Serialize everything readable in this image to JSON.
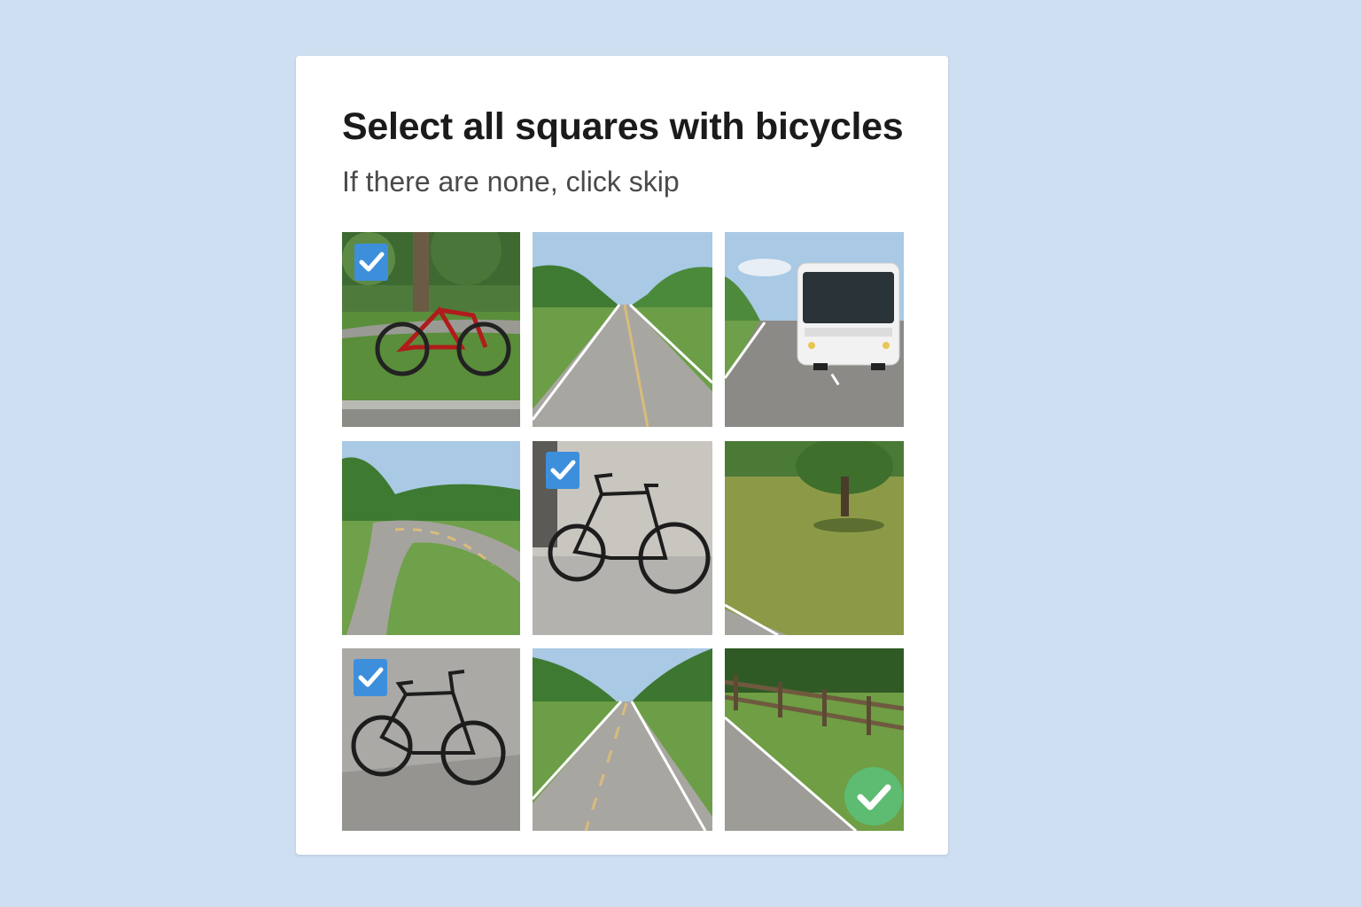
{
  "challenge": {
    "title": "Select all squares with bicycles",
    "subtitle": "If there are none, click skip"
  },
  "tiles": [
    {
      "scene": "red bicycle on grass",
      "selected": true
    },
    {
      "scene": "straight road through trees",
      "selected": false
    },
    {
      "scene": "white bus on road",
      "selected": false
    },
    {
      "scene": "curving road",
      "selected": false
    },
    {
      "scene": "black bicycle against wall",
      "selected": true
    },
    {
      "scene": "grass field with tree",
      "selected": false
    },
    {
      "scene": "black bicycle on pavement",
      "selected": true
    },
    {
      "scene": "straight road with trees",
      "selected": false
    },
    {
      "scene": "road with wooden fence",
      "selected": false
    }
  ],
  "icons": {
    "tile_check": "checkmark-icon",
    "verified": "verified-check-icon"
  },
  "colors": {
    "background": "#cddff0",
    "checkbox": "#3d8fdc",
    "verified": "#5dbb72"
  }
}
